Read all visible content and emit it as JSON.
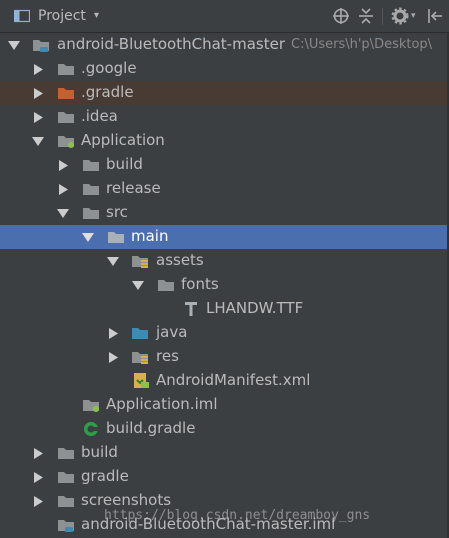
{
  "header": {
    "title": "Project",
    "icons": [
      "project-icon",
      "locate-icon",
      "collapse-all-icon",
      "gear-icon",
      "hide-icon"
    ]
  },
  "tree": {
    "root": {
      "label": "android-BluetoothChat-master",
      "path": "C:\\Users\\h'p\\Desktop\\"
    },
    "google": ".google",
    "gradle_dir": ".gradle",
    "idea": ".idea",
    "application": "Application",
    "build": "build",
    "release": "release",
    "src": "src",
    "main": "main",
    "assets": "assets",
    "fonts": "fonts",
    "ttf": "LHANDW.TTF",
    "java": "java",
    "res": "res",
    "manifest": "AndroidManifest.xml",
    "app_iml": "Application.iml",
    "build_gradle": "build.gradle",
    "root_build": "build",
    "root_gradle": "gradle",
    "screenshots": "screenshots",
    "root_iml": "android-BluetoothChat-master.iml"
  },
  "watermark": "https://blog.csdn.net/dreamboy_gns",
  "colors": {
    "background": "#3c3f41",
    "selection": "#4b6eaf",
    "git_ignored_row": "#473b33",
    "folder": "#8e9192",
    "folder_orange": "#c75f2e",
    "folder_blue": "#3b8bb5",
    "text": "#bbbbbb"
  }
}
